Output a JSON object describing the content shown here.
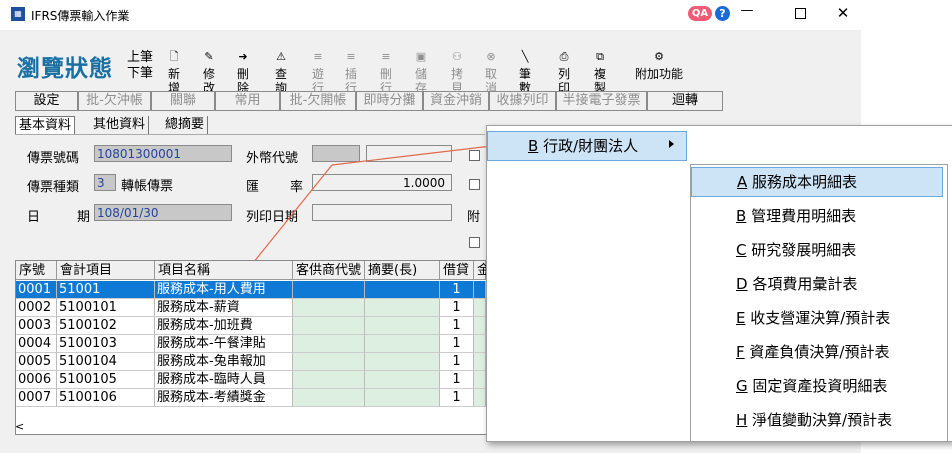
{
  "window": {
    "title": "IFRS傳票輸入作業",
    "qa_badge": "QA",
    "help": "?",
    "minimize": "—",
    "close": "✕"
  },
  "toolbar": {
    "state": "瀏覽狀態",
    "prev": "上筆",
    "next": "下筆",
    "buttons": [
      {
        "label": "新增",
        "icon": "new-doc-icon",
        "glyph": "🗋"
      },
      {
        "label": "修改",
        "icon": "edit-icon",
        "glyph": "✎"
      },
      {
        "label": "刪除",
        "icon": "delete-icon",
        "glyph": "➜"
      },
      {
        "label": "查詢",
        "icon": "search-icon",
        "glyph": "⚠"
      },
      {
        "label": "遊行",
        "icon": "insert-row-icon",
        "glyph": "≡"
      },
      {
        "label": "插行",
        "icon": "insert-row-icon",
        "glyph": "≡"
      },
      {
        "label": "刪行",
        "icon": "delete-row-icon",
        "glyph": "≡"
      },
      {
        "label": "儲存",
        "icon": "save-icon",
        "glyph": "▣"
      },
      {
        "label": "拷貝",
        "icon": "copy-icon",
        "glyph": "⚇"
      },
      {
        "label": "取消",
        "icon": "cancel-icon",
        "glyph": "⊗"
      },
      {
        "label": "筆數",
        "icon": "count-icon",
        "glyph": "╲"
      },
      {
        "label": "列印",
        "icon": "print-icon",
        "glyph": "⎙"
      },
      {
        "label": "複製",
        "icon": "duplicate-icon",
        "glyph": "⧉"
      },
      {
        "label": "附加功能",
        "icon": "extra-function-icon",
        "glyph": "⚙"
      }
    ]
  },
  "row2": {
    "buttons": [
      "設定",
      "批-欠沖帳",
      "關聯",
      "常用",
      "批-欠開帳",
      "即時分攤",
      "資金沖銷",
      "收據列印",
      "半接電子發票",
      "迴轉"
    ]
  },
  "tabs": [
    "基本資料",
    "其他資料",
    "總摘要"
  ],
  "form": {
    "voucher_no_label": "傳票號碼",
    "voucher_no": "10801300001",
    "currency_label": "外幣代號",
    "voucher_type_label": "傳票種類",
    "voucher_type_code": "3",
    "voucher_type_name": "轉帳傳票",
    "rate_label_1": "匯",
    "rate_label_2": "率",
    "rate": "1.0000",
    "date_label_1": "日",
    "date_label_2": "期",
    "date": "108/01/30",
    "print_date_label": "列印日期",
    "attach_label": "附"
  },
  "grid": {
    "headers": [
      "序號",
      "會計項目",
      "項目名稱",
      "客供商代號",
      "摘要(長)",
      "借貸",
      "金"
    ],
    "rows": [
      [
        "0001",
        "51001",
        "服務成本-用人費用",
        "",
        "",
        "1"
      ],
      [
        "0002",
        "5100101",
        "服務成本-薪資",
        "",
        "",
        "1"
      ],
      [
        "0003",
        "5100102",
        "服務成本-加班費",
        "",
        "",
        "1"
      ],
      [
        "0004",
        "5100103",
        "服務成本-午餐津貼",
        "",
        "",
        "1"
      ],
      [
        "0005",
        "5100104",
        "服務成本-兔串報加",
        "",
        "",
        "1"
      ],
      [
        "0006",
        "5100105",
        "服務成本-臨時人員",
        "",
        "",
        "1"
      ],
      [
        "0007",
        "5100106",
        "服務成本-考績獎金",
        "",
        "",
        "1"
      ]
    ],
    "scroll_left": "<"
  },
  "menu": {
    "parent": {
      "key": "B",
      "label": " 行政/財團法人"
    },
    "items": [
      {
        "key": "A",
        "label": " 服務成本明細表"
      },
      {
        "key": "B",
        "label": " 管理費用明細表"
      },
      {
        "key": "C",
        "label": " 研究發展明細表"
      },
      {
        "key": "D",
        "label": " 各項費用彙計表"
      },
      {
        "key": "E",
        "label": " 收支營運決算/預計表"
      },
      {
        "key": "F",
        "label": " 資產負債決算/預計表"
      },
      {
        "key": "G",
        "label": " 固定資產投資明細表"
      },
      {
        "key": "H",
        "label": " 淨值變動決算/預計表"
      }
    ]
  },
  "colors": {
    "selected_row": "#0f79d6",
    "state_label": "#1a6fa3",
    "menu_highlight": "#cde4f7",
    "annotation_line": "#e2694a"
  }
}
